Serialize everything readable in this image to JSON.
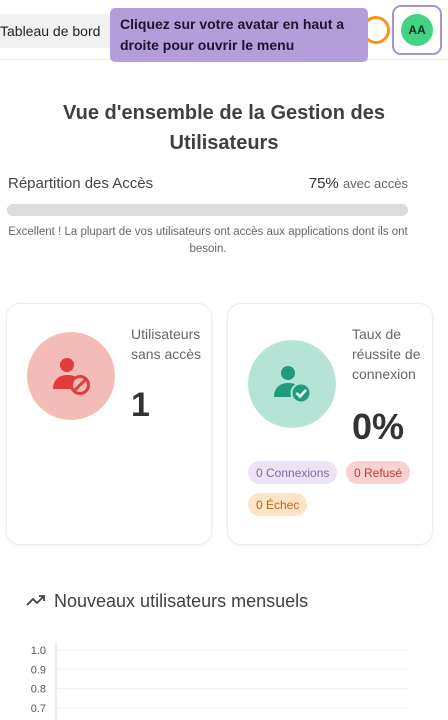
{
  "header": {
    "breadcrumb": "Tableau de bord",
    "tooltip": "Cliquez sur votre avatar en haut a droite pour ouvrir le menu",
    "avatar_initials": "AA"
  },
  "main": {
    "title": "Vue d'ensemble de la Gestion des Utilisateurs",
    "access": {
      "label": "Répartition des Accès",
      "percent": "75%",
      "suffix": "avec accès",
      "note": "Excellent ! La plupart de vos utilisateurs ont accès aux applications dont ils ont besoin."
    },
    "cards": [
      {
        "label": "Utilisateurs sans accès",
        "value": "1",
        "icon": "user-blocked-icon"
      },
      {
        "label": "Taux de réussite de connexion",
        "value": "0%",
        "icon": "user-check-icon",
        "pills": [
          "0 Connexions",
          "0 Refusé",
          "0 Échec"
        ]
      }
    ],
    "chart_section": {
      "title": "Nouveaux utilisateurs mensuels",
      "icon": "trending-up-icon"
    }
  },
  "colors": {
    "accent": "#b39ddb",
    "avatar": "#43d483",
    "highlight": "#f7941d",
    "danger": "#e03c3c",
    "success": "#1f9c7c"
  },
  "chart_data": {
    "type": "line",
    "title": "Nouveaux utilisateurs mensuels",
    "xlabel": "",
    "ylabel": "",
    "y_ticks": [
      "1.0",
      "0.9",
      "0.8",
      "0.7"
    ],
    "ylim": [
      0.7,
      1.0
    ],
    "series": [],
    "grid": true
  }
}
